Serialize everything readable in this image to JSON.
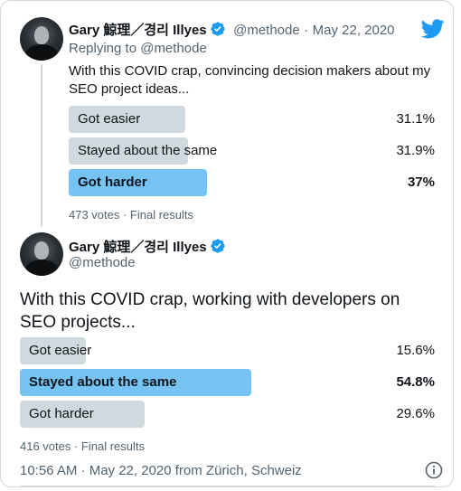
{
  "colors": {
    "brand": "#1d9bf0",
    "winner_bar": "#75c3f3",
    "bar": "#cfd9de",
    "muted": "#536471"
  },
  "quoted_tweet": {
    "author_name": "Gary 鯨理／경리 Illyes",
    "handle": "@methode",
    "separator": "·",
    "date": "May 22, 2020",
    "replying_to": "Replying to @methode",
    "text": "With this COVID crap, convincing decision makers about my SEO project ideas...",
    "poll": {
      "options": [
        {
          "label": "Got easier",
          "percent": "31.1%",
          "value": 31.1,
          "winner": false
        },
        {
          "label": "Stayed about the same",
          "percent": "31.9%",
          "value": 31.9,
          "winner": false
        },
        {
          "label": "Got harder",
          "percent": "37%",
          "value": 37.0,
          "winner": true
        }
      ],
      "summary": "473 votes · Final results"
    }
  },
  "main_tweet": {
    "author_name": "Gary 鯨理／경리 Illyes",
    "handle": "@methode",
    "text": "With this COVID crap, working with developers on SEO projects...",
    "poll": {
      "options": [
        {
          "label": "Got easier",
          "percent": "15.6%",
          "value": 15.6,
          "winner": false
        },
        {
          "label": "Stayed about the same",
          "percent": "54.8%",
          "value": 54.8,
          "winner": true
        },
        {
          "label": "Got harder",
          "percent": "29.6%",
          "value": 29.6,
          "winner": false
        }
      ],
      "summary": "416 votes · Final results"
    },
    "timestamp": "10:56 AM · May 22, 2020 from Zürich, Schweiz"
  },
  "icons": {
    "brand": "twitter-bird-icon",
    "verified": "verified-badge-icon",
    "info": "info-icon"
  }
}
